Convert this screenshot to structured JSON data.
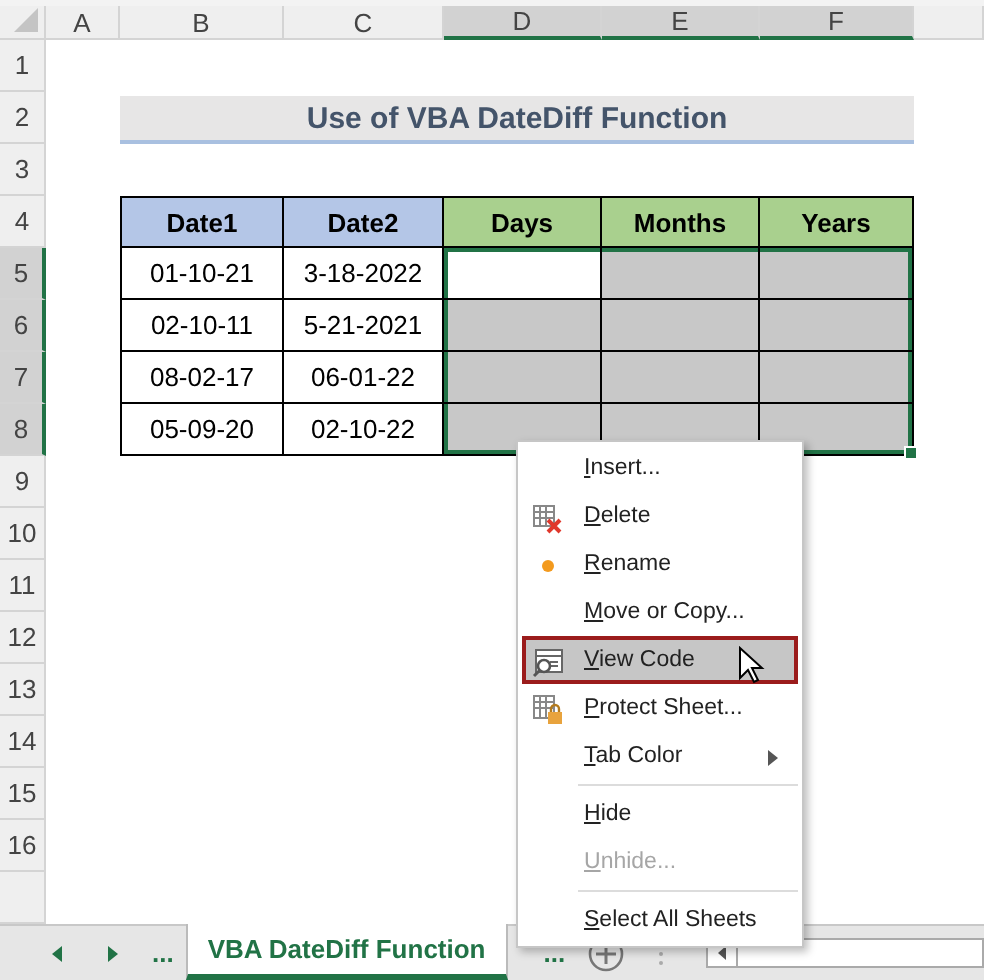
{
  "columns": [
    {
      "label": "A",
      "selected": false
    },
    {
      "label": "B",
      "selected": false
    },
    {
      "label": "C",
      "selected": false
    },
    {
      "label": "D",
      "selected": true
    },
    {
      "label": "E",
      "selected": true
    },
    {
      "label": "F",
      "selected": true
    }
  ],
  "row_headers": [
    {
      "label": "1",
      "selected": false
    },
    {
      "label": "2",
      "selected": false
    },
    {
      "label": "3",
      "selected": false
    },
    {
      "label": "4",
      "selected": false
    },
    {
      "label": "5",
      "selected": true
    },
    {
      "label": "6",
      "selected": true
    },
    {
      "label": "7",
      "selected": true
    },
    {
      "label": "8",
      "selected": true
    },
    {
      "label": "9",
      "selected": false
    },
    {
      "label": "10",
      "selected": false
    },
    {
      "label": "11",
      "selected": false
    },
    {
      "label": "12",
      "selected": false
    },
    {
      "label": "13",
      "selected": false
    },
    {
      "label": "14",
      "selected": false
    },
    {
      "label": "15",
      "selected": false
    },
    {
      "label": "16",
      "selected": false
    }
  ],
  "title": "Use of VBA DateDiff Function",
  "table": {
    "columns": [
      {
        "label": "Date1",
        "kind": "input"
      },
      {
        "label": "Date2",
        "kind": "input"
      },
      {
        "label": "Days",
        "kind": "output"
      },
      {
        "label": "Months",
        "kind": "output"
      },
      {
        "label": "Years",
        "kind": "output"
      }
    ],
    "rows": [
      {
        "cells": [
          {
            "text": "01-10-21"
          },
          {
            "text": "3-18-2022"
          },
          {
            "selected": true,
            "active": true
          },
          {
            "selected": true,
            "active": false
          },
          {
            "selected": true,
            "active": false
          }
        ]
      },
      {
        "cells": [
          {
            "text": "02-10-11"
          },
          {
            "text": "5-21-2021"
          },
          {
            "selected": true,
            "active": false
          },
          {
            "selected": true,
            "active": false
          },
          {
            "selected": true,
            "active": false
          }
        ]
      },
      {
        "cells": [
          {
            "text": "08-02-17"
          },
          {
            "text": "06-01-22"
          },
          {
            "selected": true,
            "active": false
          },
          {
            "selected": true,
            "active": false
          },
          {
            "selected": true,
            "active": false
          }
        ]
      },
      {
        "cells": [
          {
            "text": "05-09-20"
          },
          {
            "text": "02-10-22"
          },
          {
            "selected": true,
            "active": false
          },
          {
            "selected": true,
            "active": false
          },
          {
            "selected": true,
            "active": false
          }
        ]
      }
    ]
  },
  "context_menu": {
    "items": [
      {
        "kind": "command",
        "label": "Insert...",
        "selected": false,
        "disabled": false
      },
      {
        "kind": "command",
        "label": "Delete",
        "selected": false,
        "disabled": false
      },
      {
        "kind": "command",
        "label": "Rename",
        "selected": false,
        "disabled": false
      },
      {
        "kind": "command",
        "label": "Move or Copy...",
        "selected": false,
        "disabled": false
      },
      {
        "kind": "command",
        "label": "View Code",
        "selected": true,
        "disabled": false
      },
      {
        "kind": "command",
        "label": "Protect Sheet...",
        "selected": false,
        "disabled": false
      },
      {
        "kind": "submenu",
        "label": "Tab Color",
        "selected": false,
        "disabled": false
      },
      {
        "kind": "separator"
      },
      {
        "kind": "command",
        "label": "Hide",
        "selected": false,
        "disabled": false
      },
      {
        "kind": "command",
        "label": "Unhide...",
        "selected": false,
        "disabled": true
      },
      {
        "kind": "separator"
      },
      {
        "kind": "command",
        "label": "Select All Sheets",
        "selected": false,
        "disabled": false
      }
    ]
  },
  "sheet_tabs": {
    "more_left": "...",
    "tabs": [
      {
        "label": "VBA DateDiff Function",
        "selected": true
      }
    ],
    "more_right": "..."
  }
}
